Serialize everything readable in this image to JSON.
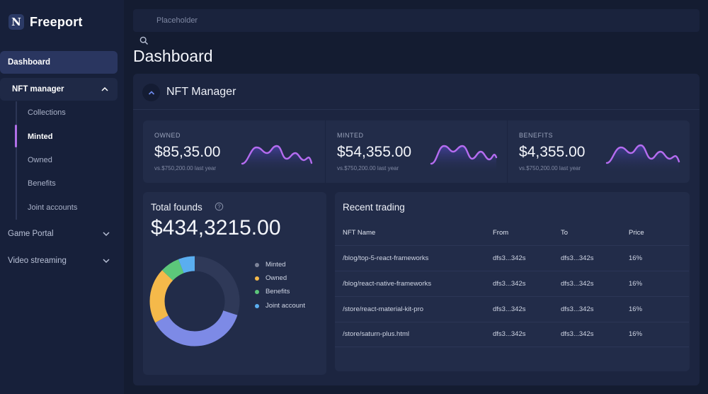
{
  "app": {
    "name": "Freeport",
    "logo_letter": "N"
  },
  "sidebar": {
    "dashboard": "Dashboard",
    "nft_manager": "NFT manager",
    "nft_items": [
      "Collections",
      "Minted",
      "Owned",
      "Benefits",
      "Joint accounts"
    ],
    "active_item": "Minted",
    "game_portal": "Game Portal",
    "video_streaming": "Video streaming"
  },
  "search": {
    "placeholder": "Placeholder"
  },
  "page": {
    "title": "Dashboard"
  },
  "panel": {
    "title": "NFT Manager"
  },
  "stats": [
    {
      "label": "OWNED",
      "value": "$85,35.00",
      "sub": "vs.$750,200.00 last year"
    },
    {
      "label": "MINTED",
      "value": "$54,355.00",
      "sub": "vs.$750,200.00 last year"
    },
    {
      "label": "BENEFITS",
      "value": "$4,355.00",
      "sub": "vs.$750,200.00 last year"
    }
  ],
  "total": {
    "title": "Total founds",
    "value": "$434,3215.00",
    "legend": [
      {
        "label": "Minted",
        "color": "#7e8499",
        "share": 0.3
      },
      {
        "label": "Owned",
        "color": "#f5b94a",
        "share": 0.2
      },
      {
        "label": "Benefits",
        "color": "#5cc77a",
        "share": 0.07
      },
      {
        "label": "Joint account",
        "color": "#5aaef0",
        "share": 0.06
      }
    ],
    "donut_colors": {
      "main": "#7d8ae6",
      "track": "#2f3958"
    }
  },
  "trading": {
    "title": "Recent trading",
    "columns": [
      "NFT Name",
      "From",
      "To",
      "Price"
    ],
    "rows": [
      [
        "/blog/top-5-react-frameworks",
        "dfs3...342s",
        "dfs3...342s",
        "16%"
      ],
      [
        "/blog/react-native-frameworks",
        "dfs3...342s",
        "dfs3...342s",
        "16%"
      ],
      [
        "/store/react-material-kit-pro",
        "dfs3...342s",
        "dfs3...342s",
        "16%"
      ],
      [
        "/store/saturn-plus.html",
        "dfs3...342s",
        "dfs3...342s",
        "16%"
      ]
    ]
  },
  "colors": {
    "accent": "#b06fe8",
    "spark": "#b56cf0"
  }
}
